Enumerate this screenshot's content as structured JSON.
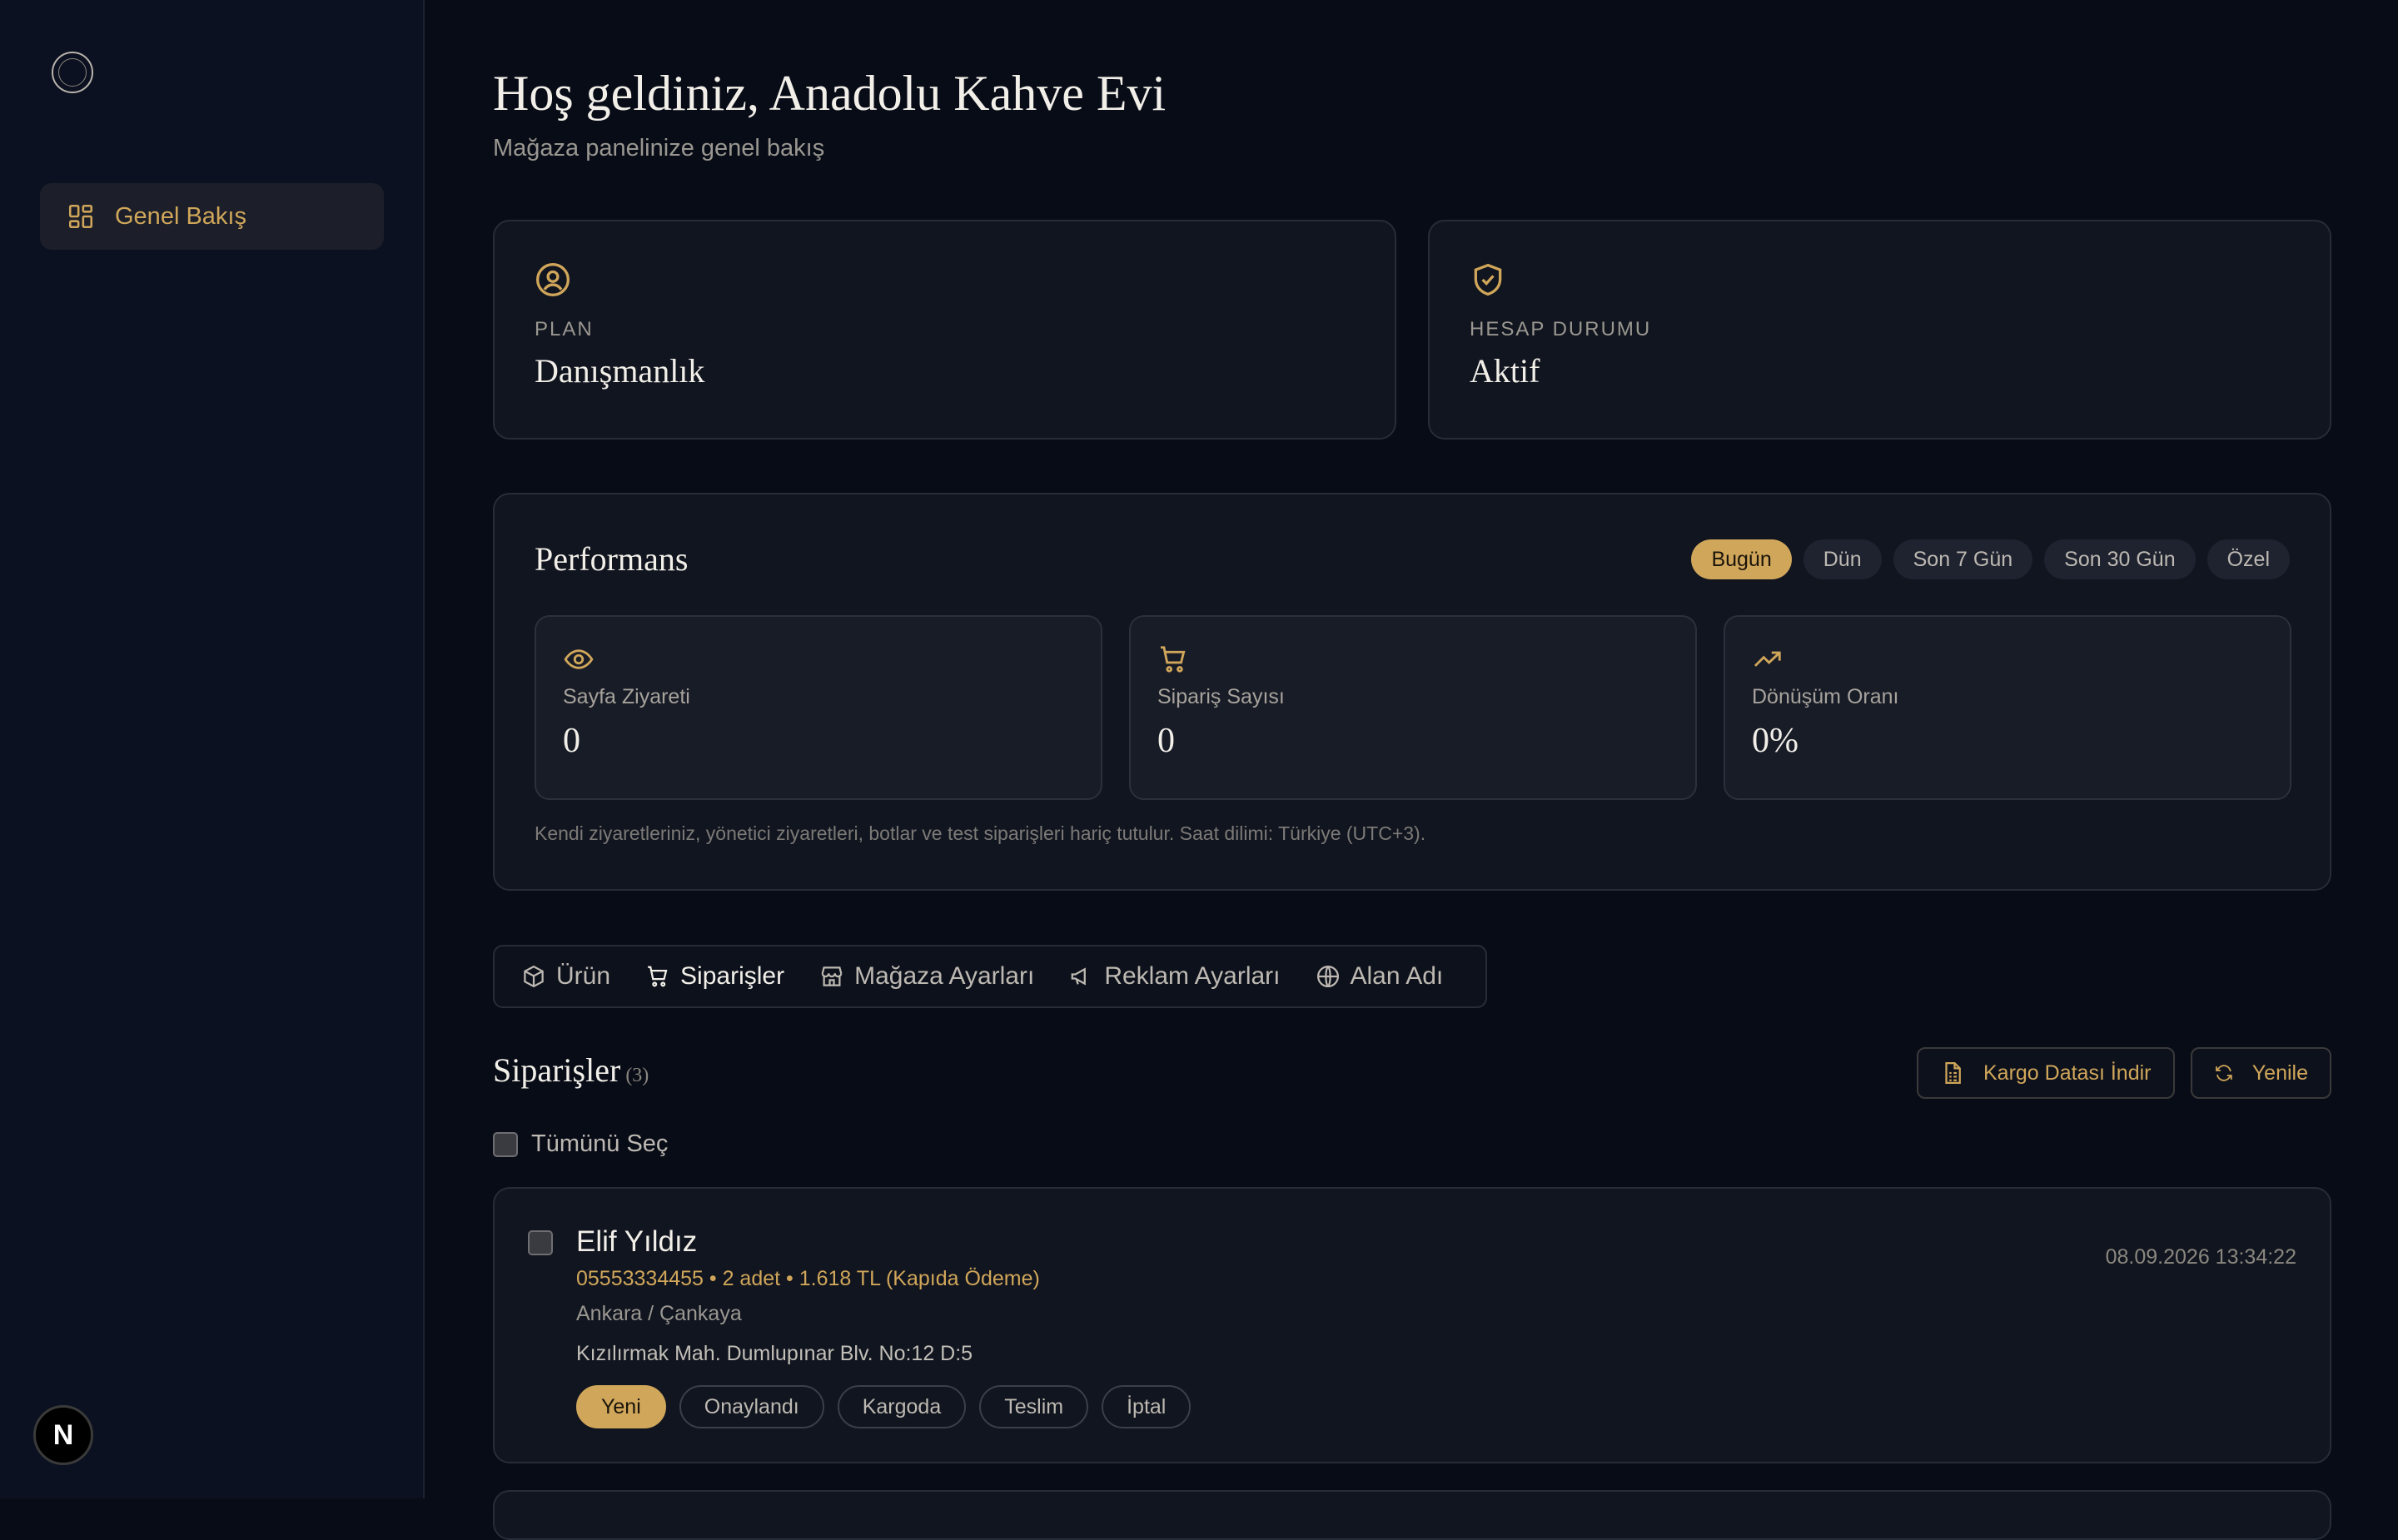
{
  "sidebar": {
    "nav_item": "Genel Bakış",
    "badge": "N"
  },
  "header": {
    "title": "Hoş geldiniz, Anadolu Kahve Evi",
    "subtitle": "Mağaza panelinize genel bakış"
  },
  "plan": {
    "label": "PLAN",
    "value": "Danışmanlık"
  },
  "account": {
    "label": "HESAP DURUMU",
    "value": "Aktif"
  },
  "performance": {
    "title": "Performans",
    "ranges": [
      "Bugün",
      "Dün",
      "Son 7 Gün",
      "Son 30 Gün",
      "Özel"
    ],
    "metrics": [
      {
        "label": "Sayfa Ziyareti",
        "value": "0",
        "icon": "eye-icon"
      },
      {
        "label": "Sipariş Sayısı",
        "value": "0",
        "icon": "cart-icon"
      },
      {
        "label": "Dönüşüm Oranı",
        "value": "0%",
        "icon": "trending-up-icon"
      }
    ],
    "note": "Kendi ziyaretleriniz, yönetici ziyaretleri, botlar ve test siparişleri hariç tutulur. Saat dilimi: Türkiye (UTC+3)."
  },
  "tabs": [
    {
      "label": "Ürün",
      "icon": "box-icon"
    },
    {
      "label": "Siparişler",
      "icon": "cart-icon"
    },
    {
      "label": "Mağaza Ayarları",
      "icon": "store-icon"
    },
    {
      "label": "Reklam Ayarları",
      "icon": "megaphone-icon"
    },
    {
      "label": "Alan Adı",
      "icon": "globe-icon"
    }
  ],
  "orders": {
    "title": "Siparişler",
    "count": "(3)",
    "download_label": "Kargo Datası İndir",
    "refresh_label": "Yenile",
    "select_all": "Tümünü Seç",
    "items": [
      {
        "name": "Elif Yıldız",
        "meta": "05553334455 • 2 adet • 1.618 TL (Kapıda Ödeme)",
        "city": "Ankara / Çankaya",
        "address": "Kızılırmak Mah. Dumlupınar Blv. No:12 D:5",
        "date": "08.09.2026 13:34:22",
        "statuses": [
          "Yeni",
          "Onaylandı",
          "Kargoda",
          "Teslim",
          "İptal"
        ]
      }
    ]
  },
  "colors": {
    "accent": "#d0a65a",
    "background": "#080c17",
    "card": "#11151f"
  }
}
